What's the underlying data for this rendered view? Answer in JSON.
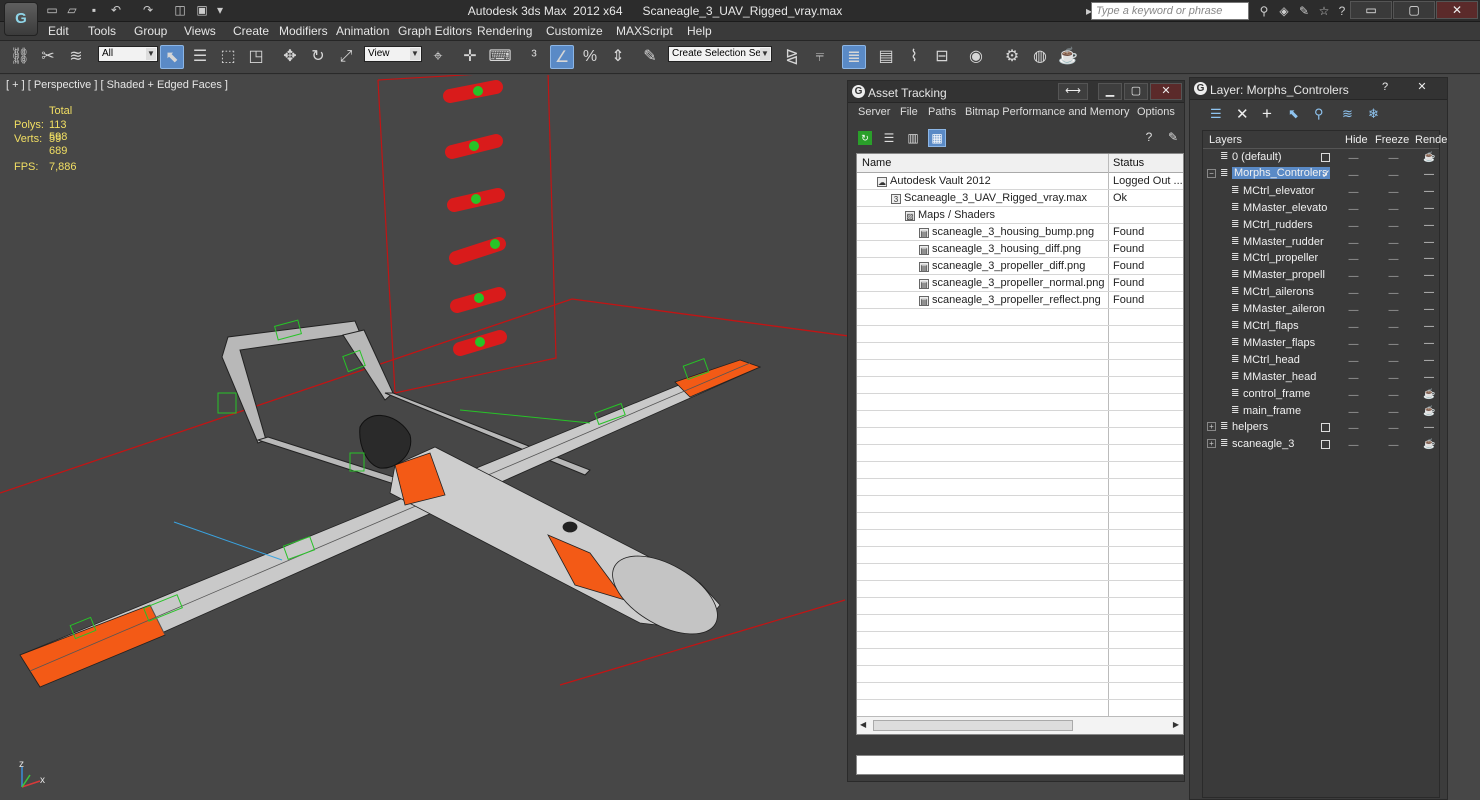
{
  "app": {
    "logo_text": "G",
    "window_title": "Autodesk 3ds Max  2012 x64      Scaneagle_3_UAV_Rigged_vray.max",
    "search_placeholder": "Type a keyword or phrase"
  },
  "menu": [
    "Edit",
    "Tools",
    "Group",
    "Views",
    "Create",
    "Modifiers",
    "Animation",
    "Graph Editors",
    "Rendering",
    "Customize",
    "MAXScript",
    "Help"
  ],
  "toolbar": {
    "selection_filter": "All",
    "reference_coord": "View",
    "named_selection": "Create Selection Se"
  },
  "viewport": {
    "label": "[ + ] [ Perspective ] [ Shaded + Edged Faces ]",
    "stats": {
      "header": "Total",
      "polys_label": "Polys:",
      "polys_value": "113 598",
      "verts_label": "Verts:",
      "verts_value": "59 689",
      "fps_label": "FPS:",
      "fps_value": "7,886"
    },
    "axis_x": "x",
    "axis_z": "z"
  },
  "asset_tracking": {
    "title": "Asset Tracking",
    "menu": [
      "Server",
      "File",
      "Paths",
      "Bitmap Performance and Memory",
      "Options"
    ],
    "columns": {
      "name": "Name",
      "status": "Status"
    },
    "rows": [
      {
        "name": "Autodesk Vault 2012",
        "status": "Logged Out ..."
      },
      {
        "name": "Scaneagle_3_UAV_Rigged_vray.max",
        "status": "Ok"
      },
      {
        "name": "Maps / Shaders",
        "status": ""
      },
      {
        "name": "scaneagle_3_housing_bump.png",
        "status": "Found"
      },
      {
        "name": "scaneagle_3_housing_diff.png",
        "status": "Found"
      },
      {
        "name": "scaneagle_3_propeller_diff.png",
        "status": "Found"
      },
      {
        "name": "scaneagle_3_propeller_normal.png",
        "status": "Found"
      },
      {
        "name": "scaneagle_3_propeller_reflect.png",
        "status": "Found"
      }
    ]
  },
  "layer_manager": {
    "title": "Layer: Morphs_Controlers",
    "help_label": "?",
    "columns": {
      "layers": "Layers",
      "hide": "Hide",
      "freeze": "Freeze",
      "render": "Rende"
    },
    "rows": [
      {
        "name": "0 (default)",
        "level": 1
      },
      {
        "name": "Morphs_Controlers",
        "level": 1,
        "selected": true
      },
      {
        "name": "MCtrl_elevator",
        "level": 2
      },
      {
        "name": "MMaster_elevato",
        "level": 2
      },
      {
        "name": "MCtrl_rudders",
        "level": 2
      },
      {
        "name": "MMaster_rudder",
        "level": 2
      },
      {
        "name": "MCtrl_propeller",
        "level": 2
      },
      {
        "name": "MMaster_propell",
        "level": 2
      },
      {
        "name": "MCtrl_ailerons",
        "level": 2
      },
      {
        "name": "MMaster_aileron",
        "level": 2
      },
      {
        "name": "MCtrl_flaps",
        "level": 2
      },
      {
        "name": "MMaster_flaps",
        "level": 2
      },
      {
        "name": "MCtrl_head",
        "level": 2
      },
      {
        "name": "MMaster_head",
        "level": 2
      },
      {
        "name": "control_frame",
        "level": 2
      },
      {
        "name": "main_frame",
        "level": 2
      },
      {
        "name": "helpers",
        "level": 1
      },
      {
        "name": "scaneagle_3",
        "level": 1
      }
    ]
  },
  "colors": {
    "accent": "#5a8ac6",
    "viewport_bg": "#474747",
    "stat_text": "#f2df63",
    "controller_red": "#d91b1b",
    "controller_green": "#27c327",
    "wing_orange": "#f35a16"
  }
}
